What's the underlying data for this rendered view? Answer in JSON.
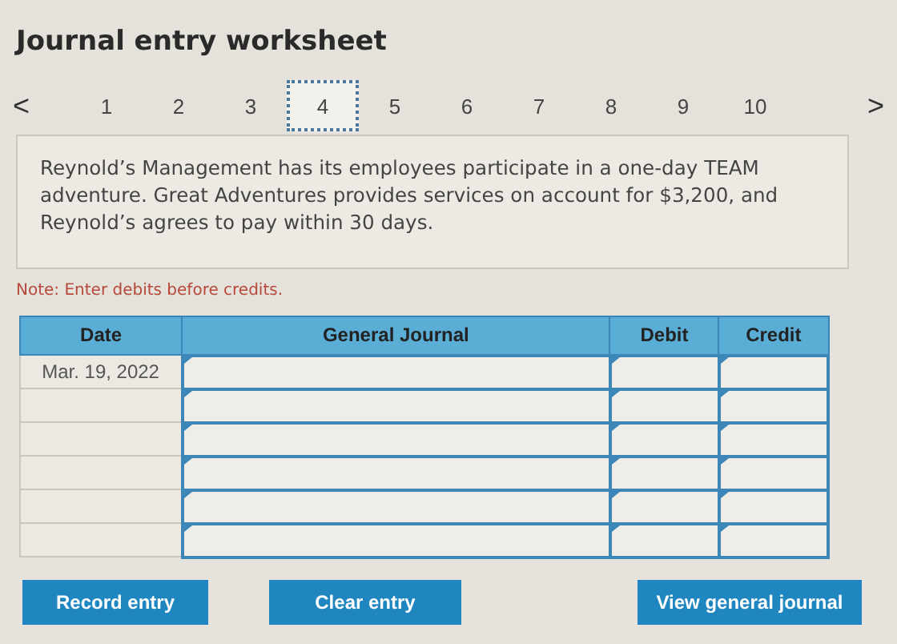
{
  "title": "Journal entry worksheet",
  "pager": {
    "prev": "<",
    "next": ">",
    "pages": [
      {
        "label": "1",
        "selected": false
      },
      {
        "label": "2",
        "selected": false
      },
      {
        "label": "3",
        "selected": false
      },
      {
        "label": "4",
        "selected": true
      },
      {
        "label": "5",
        "selected": false
      },
      {
        "label": "6",
        "selected": false
      },
      {
        "label": "7",
        "selected": false
      },
      {
        "label": "8",
        "selected": false
      },
      {
        "label": "9",
        "selected": false
      },
      {
        "label": "10",
        "selected": false
      }
    ]
  },
  "problem": "Reynold’s Management has its employees participate in a one-day TEAM adventure. Great Adventures provides services on account for $3,200, and Reynold’s agrees to pay within 30 days.",
  "note": "Note: Enter debits before credits.",
  "table": {
    "columns": [
      "Date",
      "General Journal",
      "Debit",
      "Credit"
    ],
    "rows": [
      {
        "date": "Mar. 19, 2022"
      },
      {},
      {},
      {},
      {},
      {}
    ]
  },
  "buttons": [
    "Record entry",
    "Clear entry",
    "View general journal"
  ]
}
